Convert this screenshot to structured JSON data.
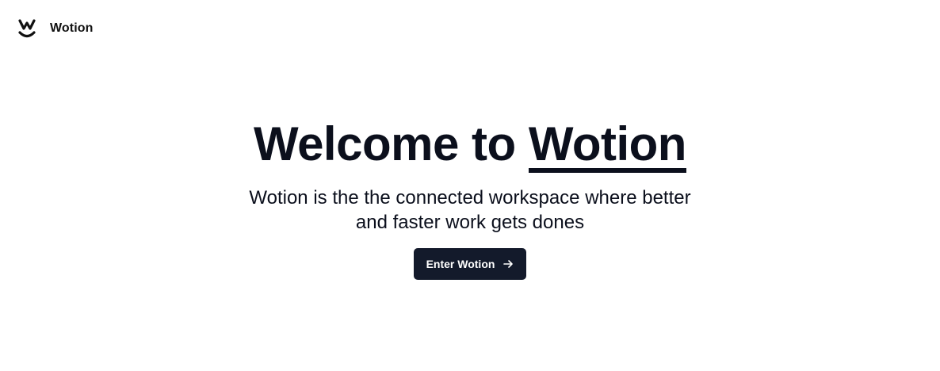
{
  "header": {
    "logo_icon": "smile-w-logo-icon",
    "brand_name": "Wotion"
  },
  "hero": {
    "title_prefix": "Welcome to",
    "title_brand": "Wotion",
    "subtitle": "Wotion is the the connected workspace where better and faster work gets dones",
    "cta_label": "Enter Wotion",
    "cta_icon": "arrow-right-icon"
  },
  "colors": {
    "text": "#0b0f1c",
    "button_bg": "#131a2b",
    "button_text": "#ffffff",
    "background": "#ffffff"
  }
}
